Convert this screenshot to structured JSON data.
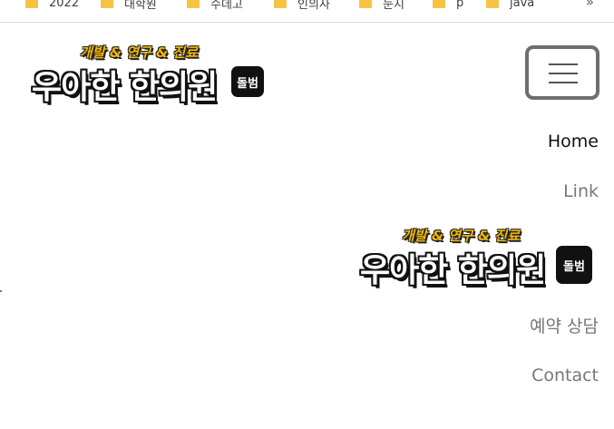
{
  "bookmarks": {
    "items": [
      {
        "label": "2022"
      },
      {
        "label": "대학원"
      },
      {
        "label": "수데고"
      },
      {
        "label": "인의사"
      },
      {
        "label": "눈지"
      },
      {
        "label": "p"
      },
      {
        "label": "java"
      }
    ],
    "overflow": "»"
  },
  "brand": {
    "tagline": "개발 & 연구 & 진료",
    "name": "우아한 한의원",
    "badge": "돌범",
    "colors": {
      "tagline": "#f2b705",
      "name": "#ffffff",
      "outline": "#111111"
    }
  },
  "navbar": {
    "toggler_icon": "hamburger-icon",
    "links": [
      {
        "label": "Home",
        "active": true
      },
      {
        "label": "Link",
        "active": false
      },
      {
        "label": "예약 상담",
        "active": false
      },
      {
        "label": "Contact",
        "active": false
      }
    ],
    "dropdown_logo": {
      "tagline": "개발 & 연구 & 진료",
      "name": "우아한 한의원",
      "badge": "돌범"
    },
    "colors": {
      "active": "#111111",
      "inactive": "#777777"
    }
  }
}
